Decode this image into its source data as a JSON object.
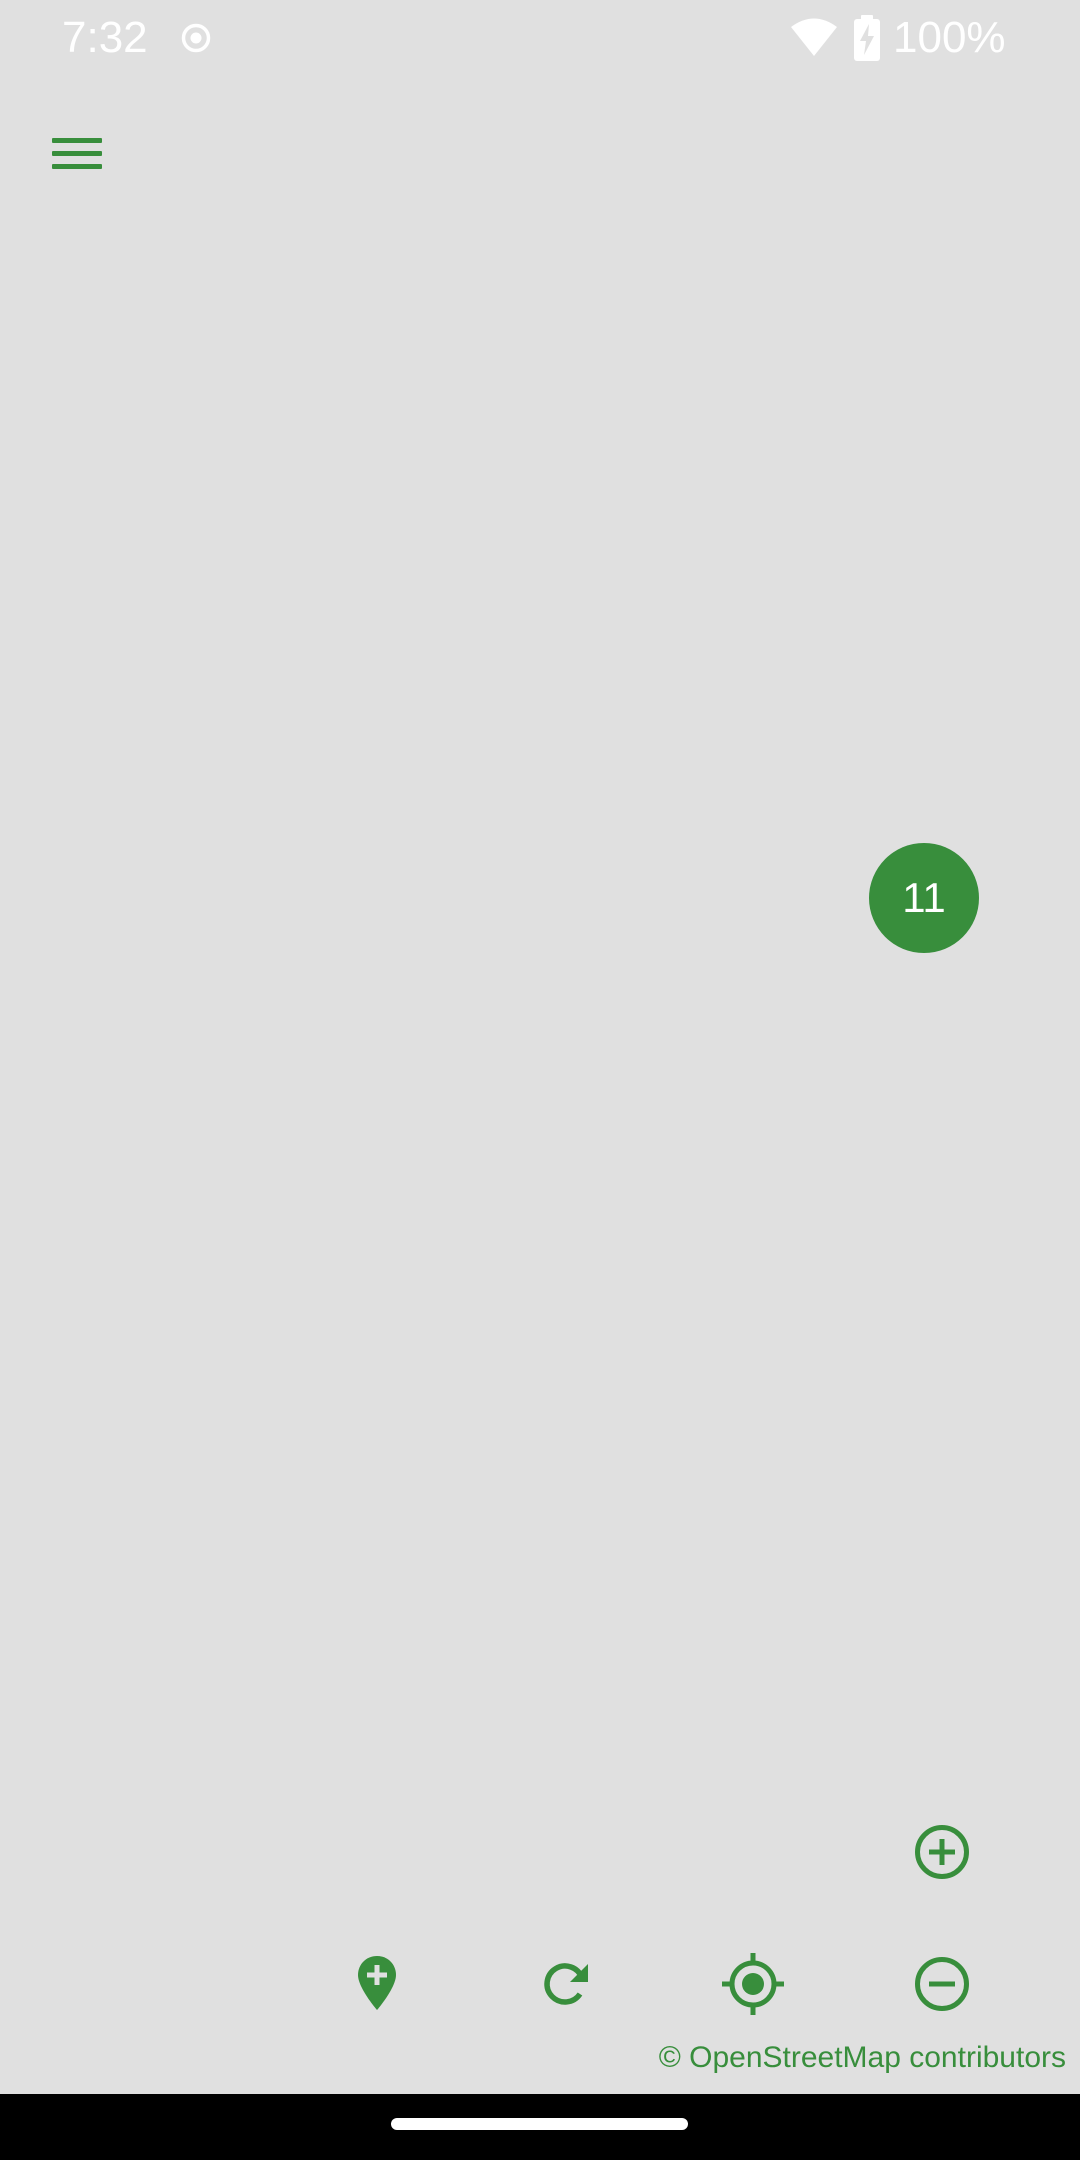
{
  "status_bar": {
    "time": "7:32",
    "record_icon": "record-circle-icon",
    "wifi_icon": "wifi-icon",
    "battery_icon": "battery-charging-icon",
    "battery_text": "100%"
  },
  "toolbar": {
    "menu_icon": "hamburger-menu-icon"
  },
  "map": {
    "cluster_count": "11",
    "attribution": "© OpenStreetMap contributors"
  },
  "controls": {
    "zoom_in_icon": "zoom-in-icon",
    "add_place_icon": "add-location-icon",
    "refresh_icon": "refresh-icon",
    "locate_icon": "my-location-icon",
    "zoom_out_icon": "zoom-out-icon"
  },
  "colors": {
    "accent": "#388e3c",
    "map_background": "#e0e0e0",
    "status_text": "#ffffff",
    "nav_bar": "#000000"
  }
}
